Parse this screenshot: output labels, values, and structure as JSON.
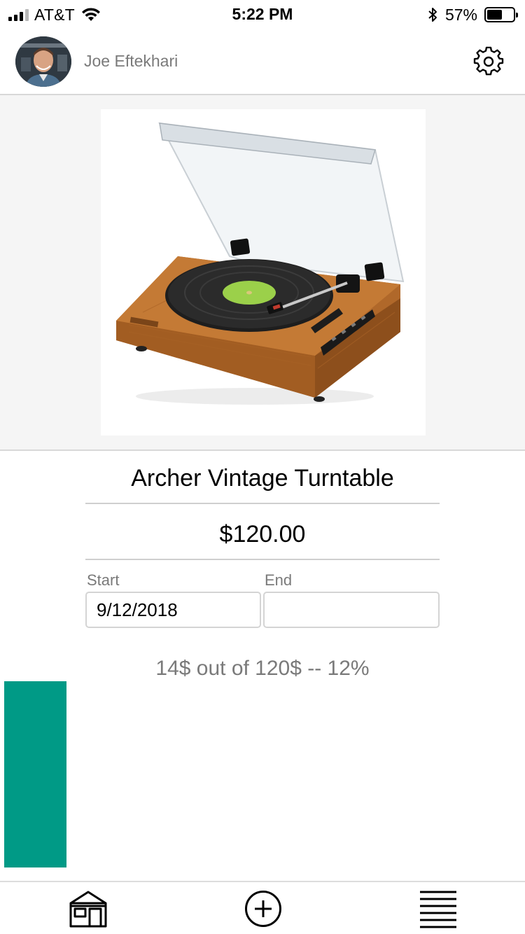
{
  "status_bar": {
    "carrier": "AT&T",
    "time": "5:22 PM",
    "battery_percent_label": "57%",
    "battery_level": 0.57,
    "icons": [
      "signal-icon",
      "wifi-icon",
      "bluetooth-icon",
      "battery-icon"
    ]
  },
  "header": {
    "user_name": "Joe Eftekhari",
    "avatar_icon": "avatar",
    "settings_icon": "gear-icon"
  },
  "product": {
    "image_icon": "turntable-image",
    "title": "Archer Vintage Turntable",
    "price": "$120.00"
  },
  "dates": {
    "start_label": "Start",
    "start_value": "9/12/2018",
    "end_label": "End",
    "end_value": ""
  },
  "progress": {
    "text": "14$ out of 120$ -- 12%",
    "fraction": 0.12,
    "color": "#009a86"
  },
  "tab_bar": {
    "items": [
      {
        "name": "home",
        "icon": "store-icon"
      },
      {
        "name": "add",
        "icon": "plus-circle-icon"
      },
      {
        "name": "menu",
        "icon": "menu-icon"
      }
    ]
  }
}
